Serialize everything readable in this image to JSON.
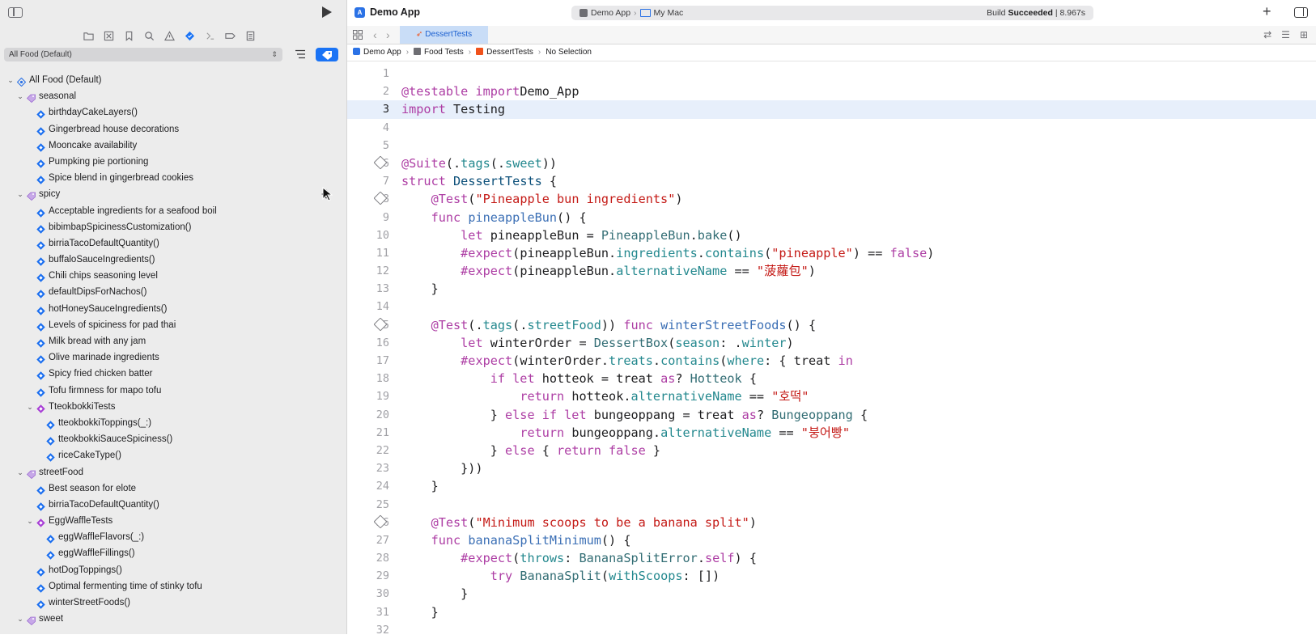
{
  "sidebar": {
    "filter_label": "All Food (Default)",
    "nav_icons": [
      "folder-icon",
      "x-square-icon",
      "bookmark-icon",
      "search-icon",
      "warning-icon",
      "test-diamond-icon",
      "debug-icon",
      "breakpoint-icon",
      "report-icon"
    ],
    "tree": [
      {
        "label": "All Food (Default)",
        "kind": "plan",
        "depth": 0,
        "chevron": true
      },
      {
        "label": "seasonal",
        "kind": "tag",
        "depth": 1,
        "chevron": true
      },
      {
        "label": "birthdayCakeLayers()",
        "kind": "test",
        "depth": 2
      },
      {
        "label": "Gingerbread house decorations",
        "kind": "test",
        "depth": 2
      },
      {
        "label": "Mooncake availability",
        "kind": "test",
        "depth": 2
      },
      {
        "label": "Pumpking pie portioning",
        "kind": "test",
        "depth": 2
      },
      {
        "label": "Spice blend in gingerbread cookies",
        "kind": "test",
        "depth": 2
      },
      {
        "label": "spicy",
        "kind": "tag",
        "depth": 1,
        "chevron": true
      },
      {
        "label": "Acceptable ingredients for a seafood boil",
        "kind": "test",
        "depth": 2
      },
      {
        "label": "bibimbapSpicinessCustomization()",
        "kind": "test",
        "depth": 2
      },
      {
        "label": "birriaTacoDefaultQuantity()",
        "kind": "test",
        "depth": 2
      },
      {
        "label": "buffaloSauceIngredients()",
        "kind": "test",
        "depth": 2
      },
      {
        "label": "Chili chips seasoning level",
        "kind": "test",
        "depth": 2
      },
      {
        "label": "defaultDipsForNachos()",
        "kind": "test",
        "depth": 2
      },
      {
        "label": "hotHoneySauceIngredients()",
        "kind": "test",
        "depth": 2
      },
      {
        "label": "Levels of spiciness for pad thai",
        "kind": "test",
        "depth": 2
      },
      {
        "label": "Milk bread with any jam",
        "kind": "test",
        "depth": 2
      },
      {
        "label": "Olive marinade ingredients",
        "kind": "test",
        "depth": 2
      },
      {
        "label": "Spicy fried chicken batter",
        "kind": "test",
        "depth": 2
      },
      {
        "label": "Tofu firmness for mapo tofu",
        "kind": "test",
        "depth": 2
      },
      {
        "label": "TteokbokkiTests",
        "kind": "suite",
        "depth": 2,
        "chevron": true
      },
      {
        "label": "tteokbokkiToppings(_:)",
        "kind": "test",
        "depth": 3
      },
      {
        "label": "tteokbokkiSauceSpiciness()",
        "kind": "test",
        "depth": 3
      },
      {
        "label": "riceCakeType()",
        "kind": "test",
        "depth": 3
      },
      {
        "label": "streetFood",
        "kind": "tag",
        "depth": 1,
        "chevron": true
      },
      {
        "label": "Best season for elote",
        "kind": "test",
        "depth": 2
      },
      {
        "label": "birriaTacoDefaultQuantity()",
        "kind": "test",
        "depth": 2
      },
      {
        "label": "EggWaffleTests",
        "kind": "suite",
        "depth": 2,
        "chevron": true
      },
      {
        "label": "eggWaffleFlavors(_:)",
        "kind": "test",
        "depth": 3
      },
      {
        "label": "eggWaffleFillings()",
        "kind": "test",
        "depth": 3
      },
      {
        "label": "hotDogToppings()",
        "kind": "test",
        "depth": 2
      },
      {
        "label": "Optimal fermenting time of stinky tofu",
        "kind": "test",
        "depth": 2
      },
      {
        "label": "winterStreetFoods()",
        "kind": "test",
        "depth": 2
      },
      {
        "label": "sweet",
        "kind": "tag",
        "depth": 1,
        "chevron": true
      }
    ]
  },
  "toolbar": {
    "app_title": "Demo App",
    "scheme": "Demo App",
    "destination": "My Mac",
    "build_prefix": "Build",
    "build_status": "Succeeded",
    "build_time": "| 8.967s"
  },
  "tab": {
    "label": "DessertTests"
  },
  "jumpbar": [
    "Demo App",
    "Food Tests",
    "DessertTests",
    "No Selection"
  ],
  "colors": {
    "accent": "#1a73f5",
    "keyword": "#ad3da4",
    "string": "#c41a16",
    "type": "#0b4f79",
    "current_line": "#e7effb"
  },
  "code": [
    {
      "n": "1",
      "segs": []
    },
    {
      "n": "2",
      "segs": [
        [
          "k",
          "@testable import"
        ],
        [
          "",
          "Demo_App"
        ]
      ]
    },
    {
      "n": "3",
      "current": true,
      "segs": [
        [
          "k",
          "import"
        ],
        [
          "",
          " Testing"
        ]
      ]
    },
    {
      "n": "4",
      "segs": []
    },
    {
      "n": "5",
      "segs": []
    },
    {
      "n": "6",
      "diamond": true,
      "segs": [
        [
          "k",
          "@Suite"
        ],
        [
          "",
          "(."
        ],
        [
          "p",
          "tags"
        ],
        [
          "",
          "(."
        ],
        [
          "p",
          "sweet"
        ],
        [
          "",
          "))"
        ]
      ]
    },
    {
      "n": "7",
      "segs": [
        [
          "k",
          "struct"
        ],
        [
          "",
          " "
        ],
        [
          "t",
          "DessertTests"
        ],
        [
          "",
          " {"
        ]
      ]
    },
    {
      "n": "8",
      "diamond": true,
      "segs": [
        [
          "",
          "    "
        ],
        [
          "k",
          "@Test"
        ],
        [
          "",
          "("
        ],
        [
          "s",
          "\"Pineapple bun ingredients\""
        ],
        [
          "",
          ")"
        ]
      ]
    },
    {
      "n": "9",
      "segs": [
        [
          "",
          "    "
        ],
        [
          "k",
          "func"
        ],
        [
          "",
          " "
        ],
        [
          "m",
          "pineappleBun"
        ],
        [
          "",
          "() {"
        ]
      ]
    },
    {
      "n": "10",
      "segs": [
        [
          "",
          "        "
        ],
        [
          "k",
          "let"
        ],
        [
          "",
          " pineappleBun = "
        ],
        [
          "f",
          "PineappleBun"
        ],
        [
          "",
          "."
        ],
        [
          "f",
          "bake"
        ],
        [
          "",
          "()"
        ]
      ]
    },
    {
      "n": "11",
      "segs": [
        [
          "",
          "        "
        ],
        [
          "k",
          "#expect"
        ],
        [
          "",
          "(pineappleBun."
        ],
        [
          "p",
          "ingredients"
        ],
        [
          "",
          "."
        ],
        [
          "p",
          "contains"
        ],
        [
          "",
          "("
        ],
        [
          "s",
          "\"pineapple\""
        ],
        [
          "",
          ") == "
        ],
        [
          "k",
          "false"
        ],
        [
          "",
          ")"
        ]
      ]
    },
    {
      "n": "12",
      "segs": [
        [
          "",
          "        "
        ],
        [
          "k",
          "#expect"
        ],
        [
          "",
          "(pineappleBun."
        ],
        [
          "p",
          "alternativeName"
        ],
        [
          "",
          " == "
        ],
        [
          "s",
          "\"菠蘿包\""
        ],
        [
          "",
          ")"
        ]
      ]
    },
    {
      "n": "13",
      "segs": [
        [
          "",
          "    }"
        ]
      ]
    },
    {
      "n": "14",
      "segs": []
    },
    {
      "n": "15",
      "diamond": true,
      "segs": [
        [
          "",
          "    "
        ],
        [
          "k",
          "@Test"
        ],
        [
          "",
          "(."
        ],
        [
          "p",
          "tags"
        ],
        [
          "",
          "(."
        ],
        [
          "p",
          "streetFood"
        ],
        [
          "",
          ")) "
        ],
        [
          "k",
          "func"
        ],
        [
          "",
          " "
        ],
        [
          "m",
          "winterStreetFoods"
        ],
        [
          "",
          "() {"
        ]
      ]
    },
    {
      "n": "16",
      "segs": [
        [
          "",
          "        "
        ],
        [
          "k",
          "let"
        ],
        [
          "",
          " winterOrder = "
        ],
        [
          "f",
          "DessertBox"
        ],
        [
          "",
          "("
        ],
        [
          "p",
          "season"
        ],
        [
          "",
          ": ."
        ],
        [
          "p",
          "winter"
        ],
        [
          "",
          ")"
        ]
      ]
    },
    {
      "n": "17",
      "segs": [
        [
          "",
          "        "
        ],
        [
          "k",
          "#expect"
        ],
        [
          "",
          "(winterOrder."
        ],
        [
          "p",
          "treats"
        ],
        [
          "",
          "."
        ],
        [
          "p",
          "contains"
        ],
        [
          "",
          "("
        ],
        [
          "p",
          "where"
        ],
        [
          "",
          ": { treat "
        ],
        [
          "k",
          "in"
        ]
      ]
    },
    {
      "n": "18",
      "segs": [
        [
          "",
          "            "
        ],
        [
          "k",
          "if let"
        ],
        [
          "",
          " hotteok = treat "
        ],
        [
          "k",
          "as"
        ],
        [
          "",
          "? "
        ],
        [
          "f",
          "Hotteok"
        ],
        [
          "",
          " {"
        ]
      ]
    },
    {
      "n": "19",
      "segs": [
        [
          "",
          "                "
        ],
        [
          "k",
          "return"
        ],
        [
          "",
          " hotteok."
        ],
        [
          "p",
          "alternativeName"
        ],
        [
          "",
          " == "
        ],
        [
          "s",
          "\"호떡\""
        ]
      ]
    },
    {
      "n": "20",
      "segs": [
        [
          "",
          "            } "
        ],
        [
          "k",
          "else if let"
        ],
        [
          "",
          " bungeoppang = treat "
        ],
        [
          "k",
          "as"
        ],
        [
          "",
          "? "
        ],
        [
          "f",
          "Bungeoppang"
        ],
        [
          "",
          " {"
        ]
      ]
    },
    {
      "n": "21",
      "segs": [
        [
          "",
          "                "
        ],
        [
          "k",
          "return"
        ],
        [
          "",
          " bungeoppang."
        ],
        [
          "p",
          "alternativeName"
        ],
        [
          "",
          " == "
        ],
        [
          "s",
          "\"붕어빵\""
        ]
      ]
    },
    {
      "n": "22",
      "segs": [
        [
          "",
          "            } "
        ],
        [
          "k",
          "else"
        ],
        [
          "",
          " { "
        ],
        [
          "k",
          "return false"
        ],
        [
          "",
          " }"
        ]
      ]
    },
    {
      "n": "23",
      "segs": [
        [
          "",
          "        }))"
        ]
      ]
    },
    {
      "n": "24",
      "segs": [
        [
          "",
          "    }"
        ]
      ]
    },
    {
      "n": "25",
      "segs": []
    },
    {
      "n": "26",
      "diamond": true,
      "segs": [
        [
          "",
          "    "
        ],
        [
          "k",
          "@Test"
        ],
        [
          "",
          "("
        ],
        [
          "s",
          "\"Minimum scoops to be a banana split\""
        ],
        [
          "",
          ")"
        ]
      ]
    },
    {
      "n": "27",
      "segs": [
        [
          "",
          "    "
        ],
        [
          "k",
          "func"
        ],
        [
          "",
          " "
        ],
        [
          "m",
          "bananaSplitMinimum"
        ],
        [
          "",
          "() {"
        ]
      ]
    },
    {
      "n": "28",
      "segs": [
        [
          "",
          "        "
        ],
        [
          "k",
          "#expect"
        ],
        [
          "",
          "("
        ],
        [
          "p",
          "throws"
        ],
        [
          "",
          ": "
        ],
        [
          "f",
          "BananaSplitError"
        ],
        [
          "",
          "."
        ],
        [
          "k",
          "self"
        ],
        [
          "",
          ") {"
        ]
      ]
    },
    {
      "n": "29",
      "segs": [
        [
          "",
          "            "
        ],
        [
          "k",
          "try"
        ],
        [
          "",
          " "
        ],
        [
          "f",
          "BananaSplit"
        ],
        [
          "",
          "("
        ],
        [
          "p",
          "withScoops"
        ],
        [
          "",
          ": [])"
        ]
      ]
    },
    {
      "n": "30",
      "segs": [
        [
          "",
          "        }"
        ]
      ]
    },
    {
      "n": "31",
      "segs": [
        [
          "",
          "    }"
        ]
      ]
    },
    {
      "n": "32",
      "segs": []
    }
  ]
}
